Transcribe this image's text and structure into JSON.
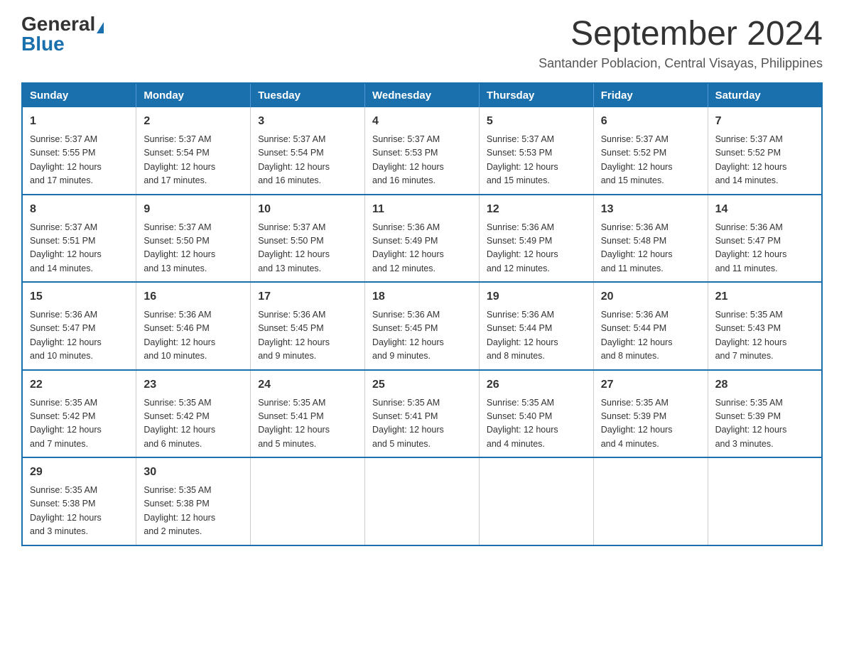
{
  "header": {
    "logo_general": "General",
    "logo_blue": "Blue",
    "month_title": "September 2024",
    "location": "Santander Poblacion, Central Visayas, Philippines"
  },
  "days_of_week": [
    "Sunday",
    "Monday",
    "Tuesday",
    "Wednesday",
    "Thursday",
    "Friday",
    "Saturday"
  ],
  "weeks": [
    [
      {
        "day": "1",
        "sunrise": "5:37 AM",
        "sunset": "5:55 PM",
        "daylight": "12 hours and 17 minutes."
      },
      {
        "day": "2",
        "sunrise": "5:37 AM",
        "sunset": "5:54 PM",
        "daylight": "12 hours and 17 minutes."
      },
      {
        "day": "3",
        "sunrise": "5:37 AM",
        "sunset": "5:54 PM",
        "daylight": "12 hours and 16 minutes."
      },
      {
        "day": "4",
        "sunrise": "5:37 AM",
        "sunset": "5:53 PM",
        "daylight": "12 hours and 16 minutes."
      },
      {
        "day": "5",
        "sunrise": "5:37 AM",
        "sunset": "5:53 PM",
        "daylight": "12 hours and 15 minutes."
      },
      {
        "day": "6",
        "sunrise": "5:37 AM",
        "sunset": "5:52 PM",
        "daylight": "12 hours and 15 minutes."
      },
      {
        "day": "7",
        "sunrise": "5:37 AM",
        "sunset": "5:52 PM",
        "daylight": "12 hours and 14 minutes."
      }
    ],
    [
      {
        "day": "8",
        "sunrise": "5:37 AM",
        "sunset": "5:51 PM",
        "daylight": "12 hours and 14 minutes."
      },
      {
        "day": "9",
        "sunrise": "5:37 AM",
        "sunset": "5:50 PM",
        "daylight": "12 hours and 13 minutes."
      },
      {
        "day": "10",
        "sunrise": "5:37 AM",
        "sunset": "5:50 PM",
        "daylight": "12 hours and 13 minutes."
      },
      {
        "day": "11",
        "sunrise": "5:36 AM",
        "sunset": "5:49 PM",
        "daylight": "12 hours and 12 minutes."
      },
      {
        "day": "12",
        "sunrise": "5:36 AM",
        "sunset": "5:49 PM",
        "daylight": "12 hours and 12 minutes."
      },
      {
        "day": "13",
        "sunrise": "5:36 AM",
        "sunset": "5:48 PM",
        "daylight": "12 hours and 11 minutes."
      },
      {
        "day": "14",
        "sunrise": "5:36 AM",
        "sunset": "5:47 PM",
        "daylight": "12 hours and 11 minutes."
      }
    ],
    [
      {
        "day": "15",
        "sunrise": "5:36 AM",
        "sunset": "5:47 PM",
        "daylight": "12 hours and 10 minutes."
      },
      {
        "day": "16",
        "sunrise": "5:36 AM",
        "sunset": "5:46 PM",
        "daylight": "12 hours and 10 minutes."
      },
      {
        "day": "17",
        "sunrise": "5:36 AM",
        "sunset": "5:45 PM",
        "daylight": "12 hours and 9 minutes."
      },
      {
        "day": "18",
        "sunrise": "5:36 AM",
        "sunset": "5:45 PM",
        "daylight": "12 hours and 9 minutes."
      },
      {
        "day": "19",
        "sunrise": "5:36 AM",
        "sunset": "5:44 PM",
        "daylight": "12 hours and 8 minutes."
      },
      {
        "day": "20",
        "sunrise": "5:36 AM",
        "sunset": "5:44 PM",
        "daylight": "12 hours and 8 minutes."
      },
      {
        "day": "21",
        "sunrise": "5:35 AM",
        "sunset": "5:43 PM",
        "daylight": "12 hours and 7 minutes."
      }
    ],
    [
      {
        "day": "22",
        "sunrise": "5:35 AM",
        "sunset": "5:42 PM",
        "daylight": "12 hours and 7 minutes."
      },
      {
        "day": "23",
        "sunrise": "5:35 AM",
        "sunset": "5:42 PM",
        "daylight": "12 hours and 6 minutes."
      },
      {
        "day": "24",
        "sunrise": "5:35 AM",
        "sunset": "5:41 PM",
        "daylight": "12 hours and 5 minutes."
      },
      {
        "day": "25",
        "sunrise": "5:35 AM",
        "sunset": "5:41 PM",
        "daylight": "12 hours and 5 minutes."
      },
      {
        "day": "26",
        "sunrise": "5:35 AM",
        "sunset": "5:40 PM",
        "daylight": "12 hours and 4 minutes."
      },
      {
        "day": "27",
        "sunrise": "5:35 AM",
        "sunset": "5:39 PM",
        "daylight": "12 hours and 4 minutes."
      },
      {
        "day": "28",
        "sunrise": "5:35 AM",
        "sunset": "5:39 PM",
        "daylight": "12 hours and 3 minutes."
      }
    ],
    [
      {
        "day": "29",
        "sunrise": "5:35 AM",
        "sunset": "5:38 PM",
        "daylight": "12 hours and 3 minutes."
      },
      {
        "day": "30",
        "sunrise": "5:35 AM",
        "sunset": "5:38 PM",
        "daylight": "12 hours and 2 minutes."
      },
      null,
      null,
      null,
      null,
      null
    ]
  ],
  "labels": {
    "sunrise": "Sunrise:",
    "sunset": "Sunset:",
    "daylight": "Daylight:"
  }
}
